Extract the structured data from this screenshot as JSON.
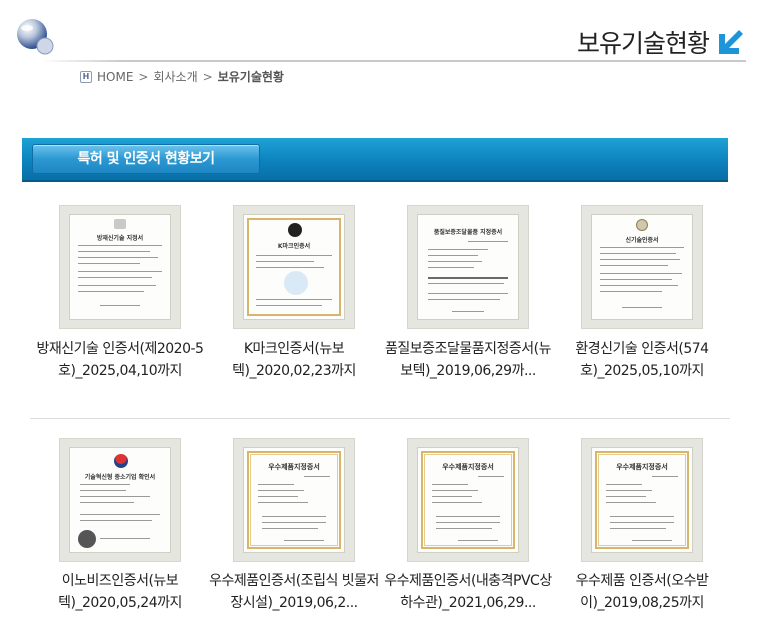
{
  "header": {
    "title": "보유기술현황"
  },
  "breadcrumb": {
    "home": "HOME",
    "parent": "회사소개",
    "current": "보유기술현황",
    "separator": ">"
  },
  "section": {
    "button_label": "특허 및 인증서 현황보기"
  },
  "certificates": [
    {
      "caption": "방재신기술 인증서(제2020-5호)_2025,04,10까지"
    },
    {
      "caption": "K마크인증서(뉴보텍)_2020,02,23까지"
    },
    {
      "caption": "품질보증조달물품지정증서(뉴보텍)_2019,06,29까..."
    },
    {
      "caption": "환경신기술 인증서(574호)_2025,05,10까지"
    },
    {
      "caption": "이노비즈인증서(뉴보텍)_2020,05,24까지"
    },
    {
      "caption": "우수제품인증서(조립식 빗물저장시설)_2019,06,2..."
    },
    {
      "caption": "우수제품인증서(내충격PVC상하수관)_2021,06,29..."
    },
    {
      "caption": "우수제품 인증서(오수받이)_2019,08,25까지"
    }
  ],
  "colors": {
    "section_bar": "#0c82bd",
    "section_button": "#2b98d2",
    "accent_arrow": "#1e95d8"
  },
  "icons": {
    "logo": "globe-orb-icon",
    "title_arrow": "arrow-down-left-icon",
    "home": "home-icon"
  }
}
